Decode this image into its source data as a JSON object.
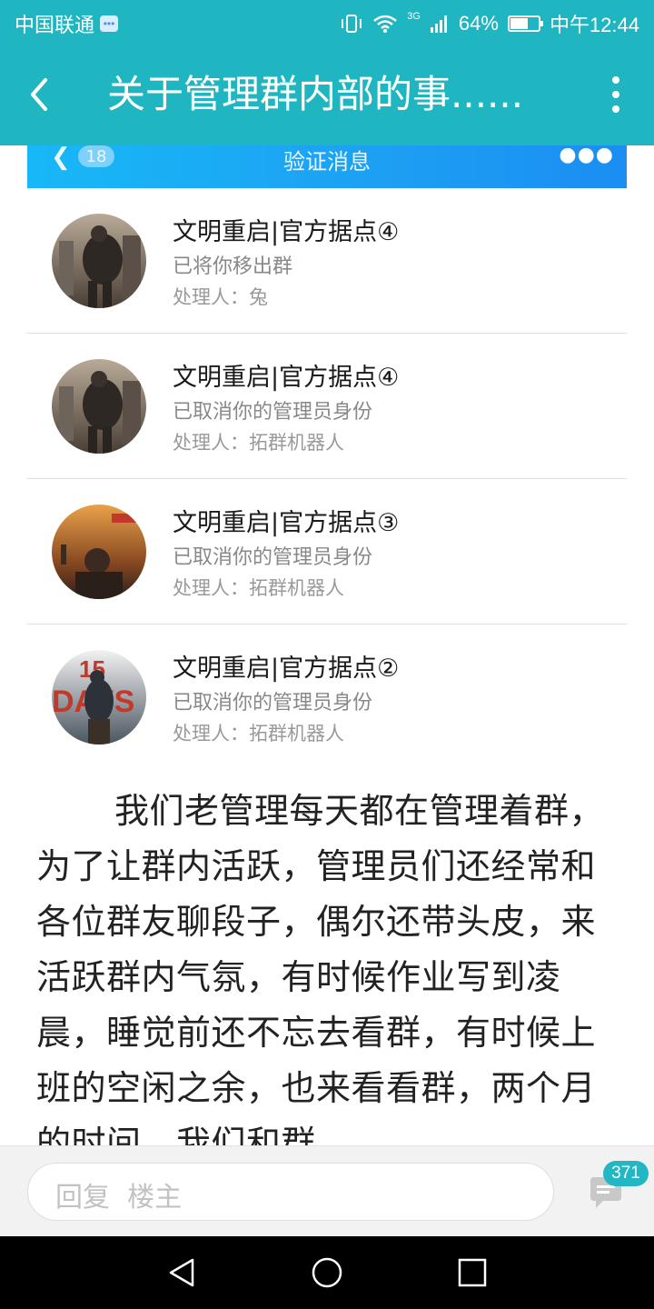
{
  "status_bar": {
    "carrier": "中国联通",
    "network": "3G",
    "battery_text": "64%",
    "battery_level": 0.64,
    "time": "中午12:44"
  },
  "nav": {
    "title": "关于管理群内部的事......",
    "background": "#1fb5c1"
  },
  "embedded_screenshot": {
    "badge_count": "18",
    "title": "验证消息",
    "accent": "#1d9ff3"
  },
  "messages": [
    {
      "group": "文明重启|官方据点④",
      "action": "已将你移出群",
      "handler": "处理人：兔"
    },
    {
      "group": "文明重启|官方据点④",
      "action": "已取消你的管理员身份",
      "handler": "处理人：拓群机器人"
    },
    {
      "group": "文明重启|官方据点③",
      "action": "已取消你的管理员身份",
      "handler": "处理人：拓群机器人"
    },
    {
      "group": "文明重启|官方据点②",
      "action": "已取消你的管理员身份",
      "handler": "处理人：拓群机器人"
    }
  ],
  "article": {
    "text": "我们老管理每天都在管理着群，为了让群内活跃，管理员们还经常和各位群友聊段子，偶尔还带头皮，来活跃群内气氛，有时候作业写到凌晨，睡觉前还不忘去看群，有时候上班的空闲之余，也来看看群，两个月的时间，我们和群"
  },
  "reply_bar": {
    "placeholder": "回复  楼主",
    "comment_count": "371"
  },
  "icons": [
    "back-arrow-icon",
    "more-vert-icon",
    "comment-icon",
    "nav-back-triangle-icon",
    "home-circle-icon",
    "recent-square-icon"
  ]
}
